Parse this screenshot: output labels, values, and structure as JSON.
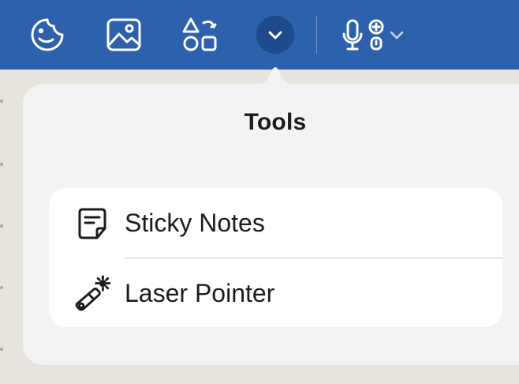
{
  "toolbar": {
    "buttons": [
      {
        "icon": "sticker-icon"
      },
      {
        "icon": "image-icon"
      },
      {
        "icon": "shapes-icon"
      },
      {
        "icon": "chevron-down-icon",
        "active": true
      },
      {
        "icon": "microphone-icon"
      },
      {
        "icon": "accessibility-icon"
      }
    ],
    "colors": {
      "background": "#2d61ad",
      "active": "#1f4a8c"
    }
  },
  "popover": {
    "title": "Tools",
    "items": [
      {
        "label": "Sticky Notes",
        "icon": "sticky-note-icon"
      },
      {
        "label": "Laser Pointer",
        "icon": "laser-pointer-icon"
      }
    ]
  }
}
